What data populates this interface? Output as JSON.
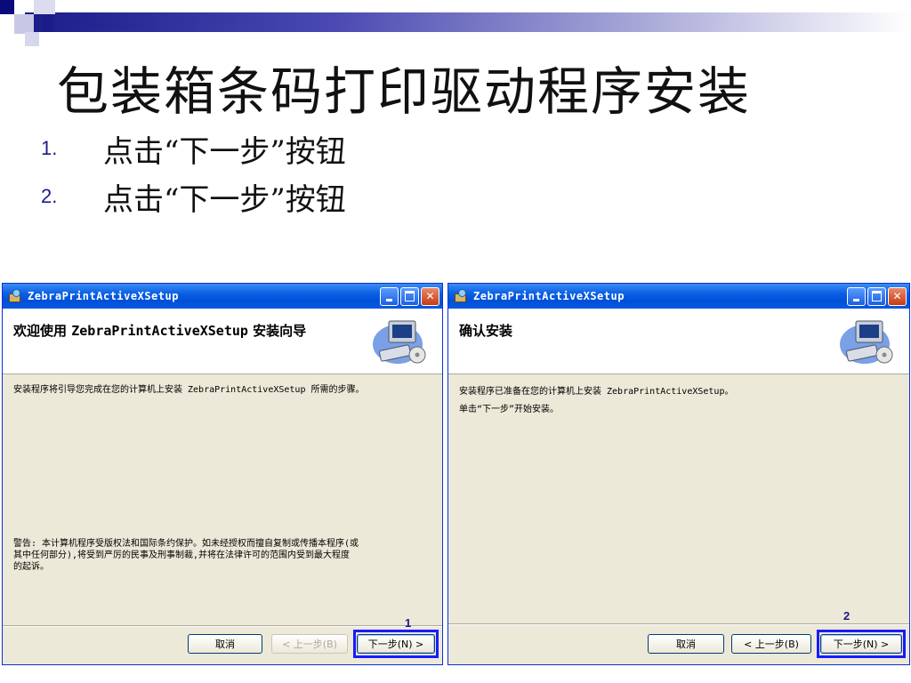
{
  "slide": {
    "title": "包装箱条码打印驱动程序安装",
    "steps": [
      {
        "num": "1.",
        "text": "点击“下一步”按钮"
      },
      {
        "num": "2.",
        "text": "点击“下一步”按钮"
      }
    ]
  },
  "dialog1": {
    "title": "ZebraPrintActiveXSetup",
    "heading_prefix": "欢迎使用 ",
    "heading_app": "ZebraPrintActiveXSetup",
    "heading_suffix": " 安装向导",
    "intro": "安装程序将引导您完成在您的计算机上安装 ZebraPrintActiveXSetup 所需的步骤。",
    "warning_lines": [
      "警告: 本计算机程序受版权法和国际条约保护。如未经授权而擅自复制或传播本程序(或",
      "其中任何部分),将受到严厉的民事及刑事制裁,并将在法律许可的范围内受到最大程度",
      "的起诉。"
    ],
    "buttons": {
      "cancel": "取消",
      "back": "< 上一步(B)",
      "next": "下一步(N) >"
    },
    "marker": "1"
  },
  "dialog2": {
    "title": "ZebraPrintActiveXSetup",
    "heading": "确认安装",
    "lines": [
      "安装程序已准备在您的计算机上安装 ZebraPrintActiveXSetup。",
      "单击“下一步”开始安装。"
    ],
    "buttons": {
      "cancel": "取消",
      "back": "< 上一步(B)",
      "next": "下一步(N) >"
    },
    "marker": "2"
  },
  "icons": {
    "app": "installer-icon",
    "banner": "computer-setup-icon"
  },
  "colors": {
    "titlebar": "#0050d8",
    "dialog_bg": "#ece9d8",
    "highlight": "#1a1aff",
    "accent": "#1b1b8a"
  }
}
